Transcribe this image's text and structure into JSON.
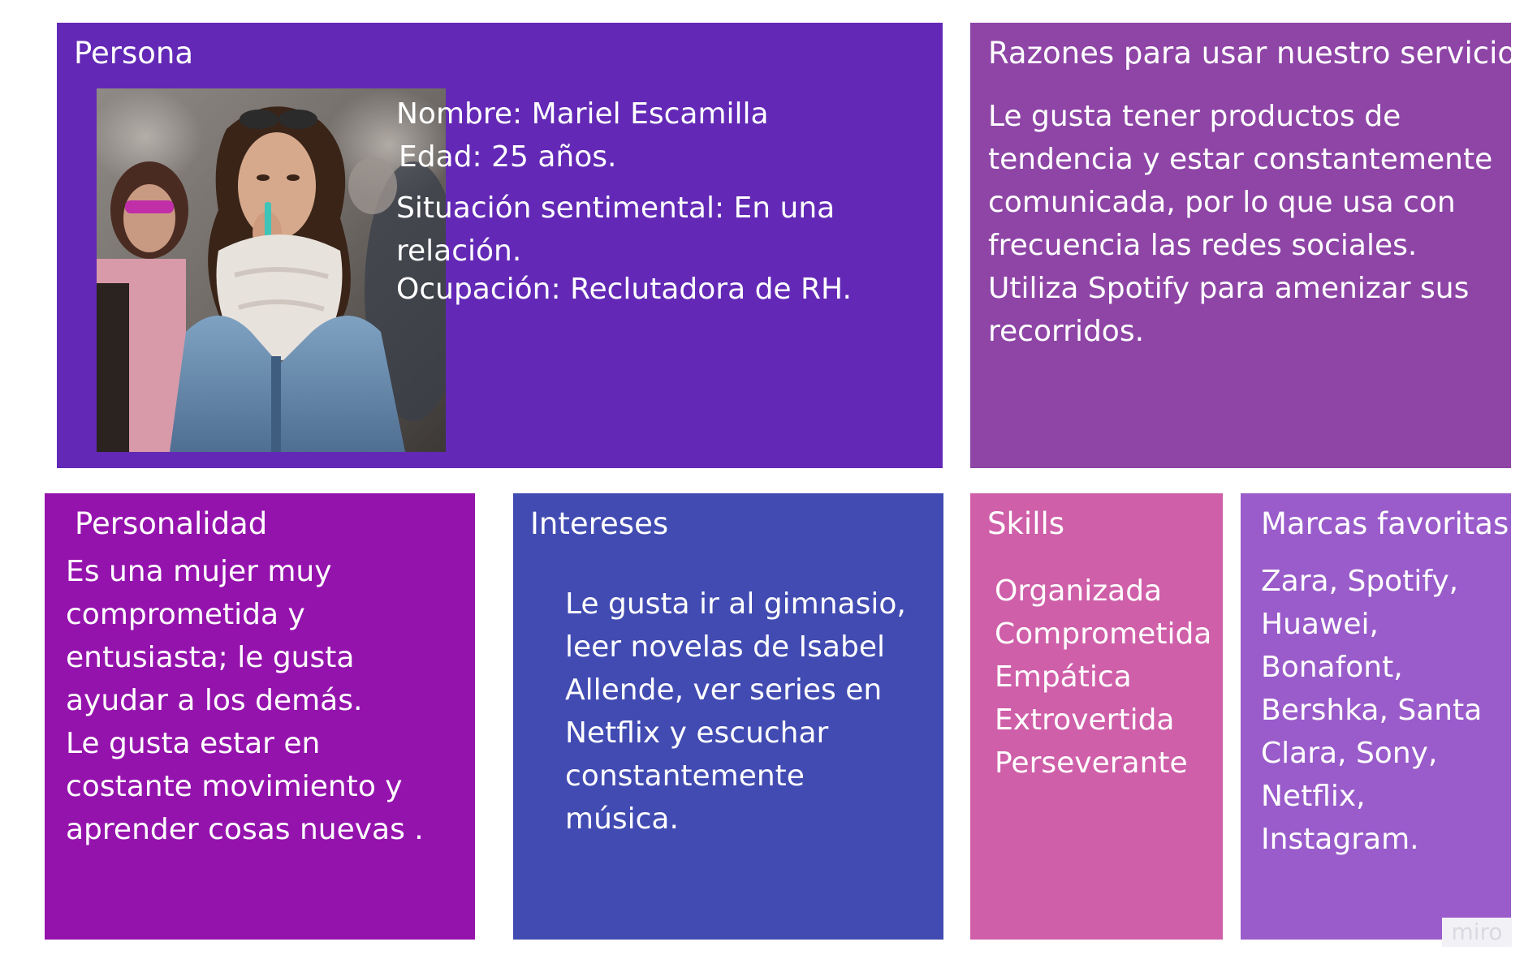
{
  "persona": {
    "title": "Persona",
    "details": [
      "Nombre: Mariel Escamilla",
      "Edad: 25 años.",
      "Situación sentimental: En una",
      "relación.",
      "Ocupación: Reclutadora de RH."
    ]
  },
  "razones": {
    "title": "Razones para usar nuestro servicios",
    "lines": [
      "Le gusta tener productos de",
      "tendencia y estar constantemente",
      "comunicada, por lo que usa con",
      "frecuencia las redes sociales.",
      "Utiliza Spotify para amenizar sus",
      "recorridos."
    ]
  },
  "personalidad": {
    "title": "Personalidad",
    "lines": [
      "Es una mujer muy",
      "comprometida y",
      "entusiasta; le gusta",
      "ayudar a los demás.",
      "Le gusta estar en",
      "costante movimiento y",
      "aprender cosas nuevas ."
    ]
  },
  "intereses": {
    "title": "Intereses",
    "lines": [
      "Le gusta ir al gimnasio,",
      "leer novelas de Isabel",
      "Allende, ver series en",
      "Netflix y escuchar",
      "constantemente",
      "música."
    ]
  },
  "skills": {
    "title": "Skills",
    "items": [
      "Organizada",
      "Comprometida",
      "Empática",
      "Extrovertida",
      "Perseverante"
    ]
  },
  "marcas": {
    "title": "Marcas favoritas",
    "lines": [
      "Zara, Spotify,",
      "Huawei,",
      "Bonafont,",
      "Bershka, Santa",
      "Clara, Sony,",
      "Netflix,",
      "Instagram."
    ]
  },
  "watermark": "miro",
  "colors": {
    "persona": "#6329b6",
    "razones": "#8e45a6",
    "personalidad": "#9513ad",
    "intereses": "#414bb2",
    "skills": "#cf5fa9",
    "marcas": "#9a5cca"
  }
}
